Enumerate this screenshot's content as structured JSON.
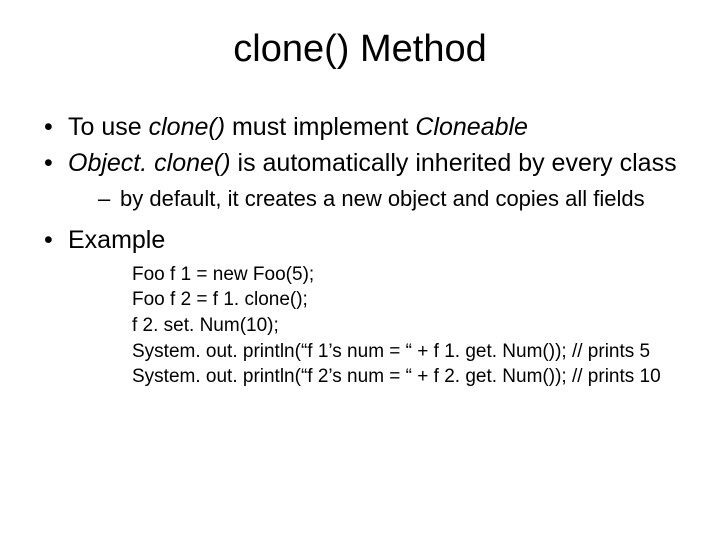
{
  "title": "clone() Method",
  "bullet1": {
    "pre": "To use ",
    "i1": "clone()",
    "mid": " must implement ",
    "i2": "Cloneable"
  },
  "bullet2": {
    "i1": "Object. clone()",
    "rest": " is automatically inherited by every class"
  },
  "sub1": "by default, it creates a new object and copies all fields",
  "bullet3": "Example",
  "code": {
    "l1": "Foo f 1 = new Foo(5);",
    "l2": "Foo f 2 = f 1. clone();",
    "l3": "f 2. set. Num(10);",
    "l4": "System. out. println(“f 1’s num = “ + f 1. get. Num()); // prints 5",
    "l5": "System. out. println(“f 2’s num = “ + f 2. get. Num()); // prints 10"
  }
}
